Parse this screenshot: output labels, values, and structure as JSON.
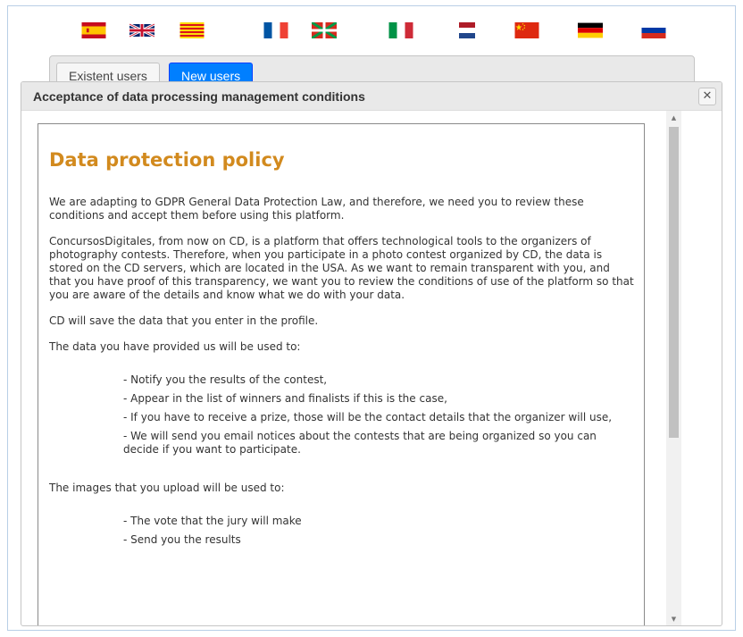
{
  "languages": [
    {
      "name": "spanish-flag"
    },
    {
      "name": "uk-flag"
    },
    {
      "name": "catalan-flag"
    },
    {
      "name": "french-flag"
    },
    {
      "name": "basque-flag"
    },
    {
      "name": "italian-flag"
    },
    {
      "name": "dutch-flag"
    },
    {
      "name": "chinese-flag"
    },
    {
      "name": "german-flag"
    },
    {
      "name": "russian-flag"
    }
  ],
  "tabs": [
    {
      "label": "Existent users"
    },
    {
      "label": "New users"
    }
  ],
  "dialog": {
    "title": "Acceptance of data processing management conditions",
    "close_icon": "close-icon"
  },
  "policy": {
    "title": "Data protection policy",
    "paragraphs": [
      "We are adapting to GDPR General Data Protection Law, and therefore, we need you to review these conditions and accept them before using this platform.",
      "ConcursosDigitales, from now on CD, is a platform that offers technological tools to the organizers of photography contests. Therefore, when you participate in a photo contest organized by CD, the data is stored on the CD servers, which are located in the USA. As we want to remain transparent with you, and that you have proof of this transparency, we want you to review the conditions of use of the platform so that you are aware of the details and know what we do with your data.",
      "CD will save the data that you enter in the profile.",
      "The data you have provided us will be used to:"
    ],
    "data_uses": [
      "- Notify you the results of the contest,",
      "- Appear in the list of winners and finalists if this is the case,",
      "- If you have to receive a prize, those will be the contact details that the organizer will use,",
      "- We will send you email notices about the contests that are being organized so you can decide if you want to participate."
    ],
    "images_intro": "The images that you upload will be used to:",
    "image_uses": [
      "- The vote that the jury will make",
      "- Send you the results"
    ]
  },
  "colors": {
    "accent": "#007fff",
    "policy_title": "#d28a1e"
  }
}
